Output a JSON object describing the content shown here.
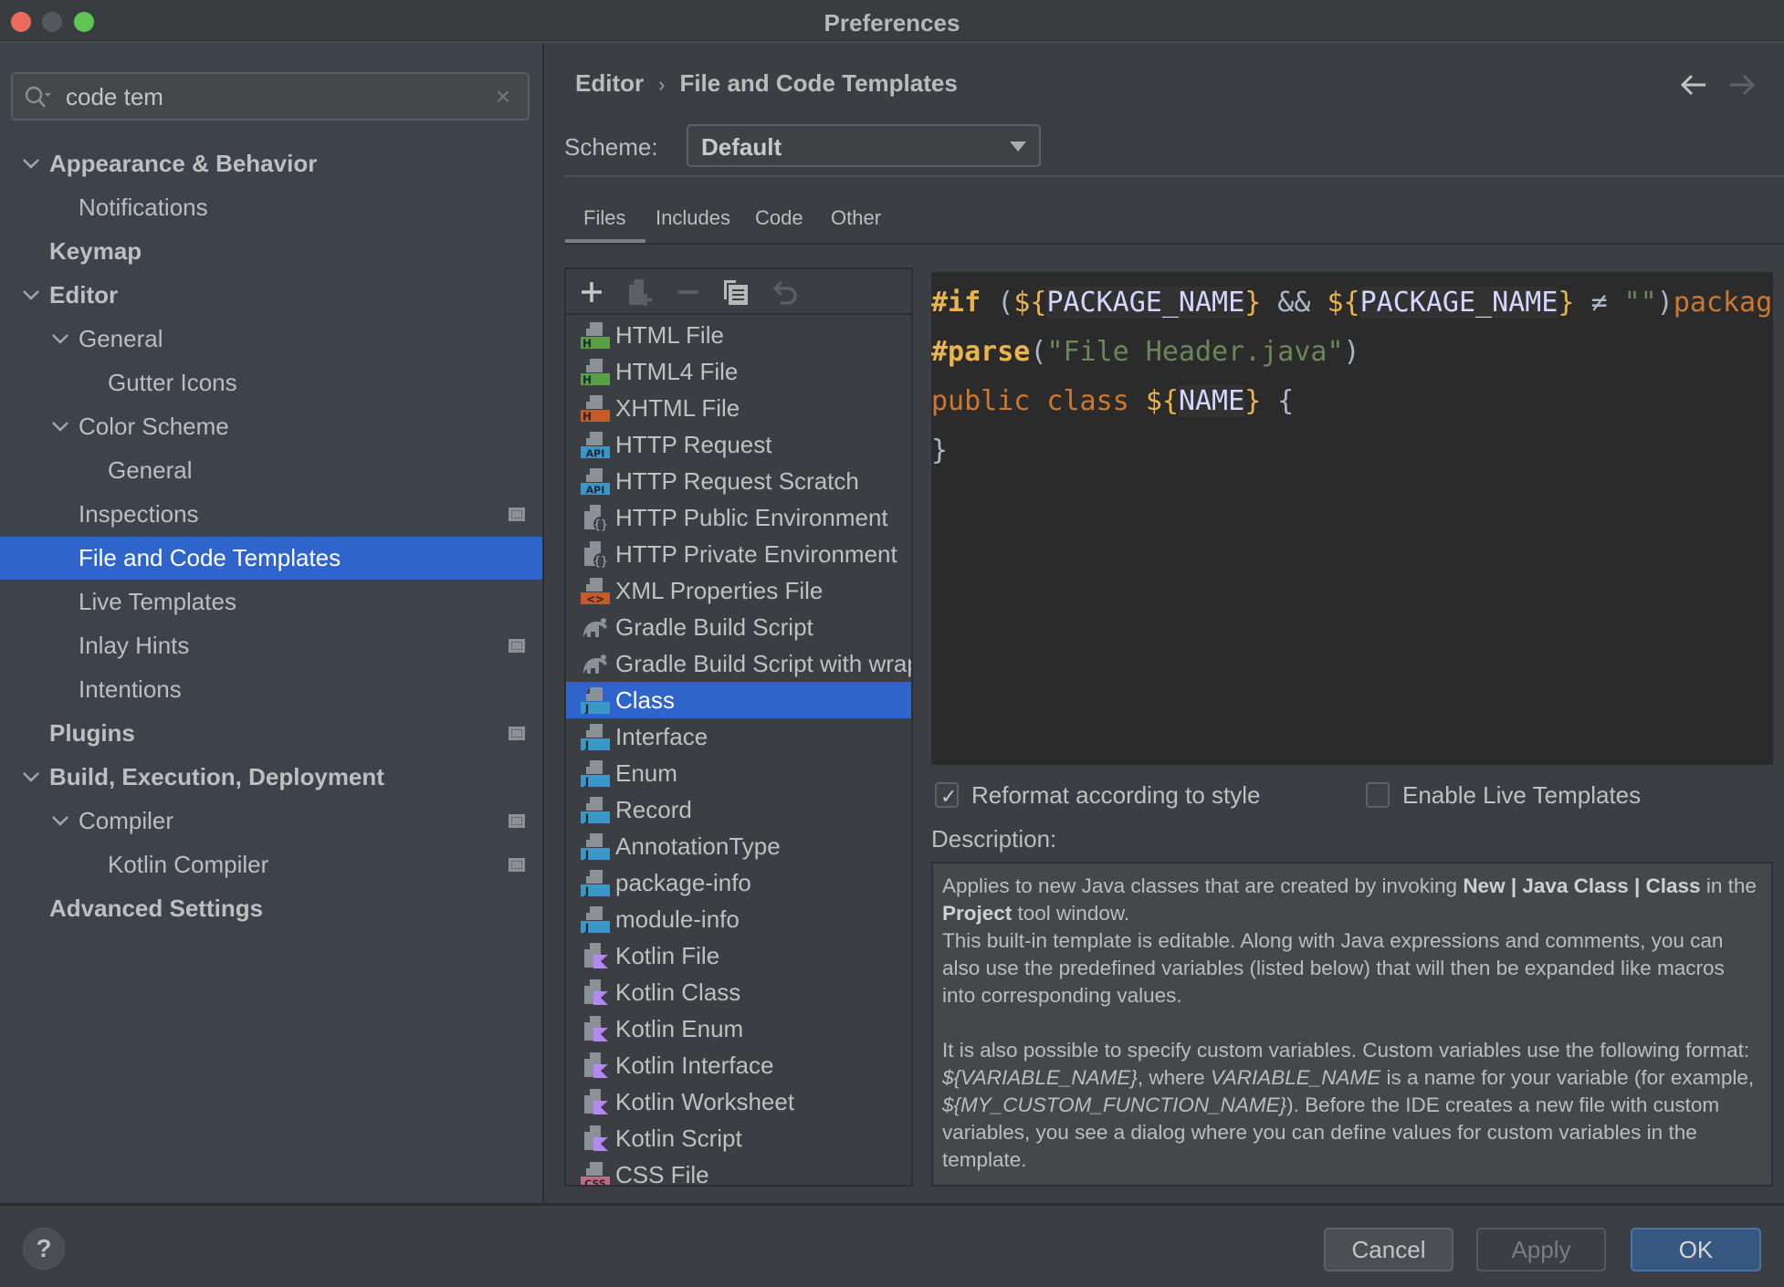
{
  "window": {
    "title": "Preferences"
  },
  "sidebar": {
    "search": {
      "value": "code tem",
      "placeholder": ""
    },
    "items": [
      {
        "label": "Appearance & Behavior",
        "level": 0,
        "bold": true,
        "expanded": true,
        "badge": false
      },
      {
        "label": "Notifications",
        "level": 1,
        "bold": false,
        "badge": false
      },
      {
        "label": "Keymap",
        "level": 0,
        "bold": true,
        "badge": false
      },
      {
        "label": "Editor",
        "level": 0,
        "bold": true,
        "expanded": true,
        "badge": false
      },
      {
        "label": "General",
        "level": 1,
        "bold": false,
        "expanded": true,
        "badge": false
      },
      {
        "label": "Gutter Icons",
        "level": 2,
        "bold": false,
        "badge": false
      },
      {
        "label": "Color Scheme",
        "level": 1,
        "bold": false,
        "expanded": true,
        "badge": false
      },
      {
        "label": "General",
        "level": 2,
        "bold": false,
        "badge": false
      },
      {
        "label": "Inspections",
        "level": 1,
        "bold": false,
        "badge": true
      },
      {
        "label": "File and Code Templates",
        "level": 1,
        "bold": false,
        "selected": true,
        "badge": false
      },
      {
        "label": "Live Templates",
        "level": 1,
        "bold": false,
        "badge": false
      },
      {
        "label": "Inlay Hints",
        "level": 1,
        "bold": false,
        "badge": true
      },
      {
        "label": "Intentions",
        "level": 1,
        "bold": false,
        "badge": false
      },
      {
        "label": "Plugins",
        "level": 0,
        "bold": true,
        "badge": true
      },
      {
        "label": "Build, Execution, Deployment",
        "level": 0,
        "bold": true,
        "expanded": true,
        "badge": false
      },
      {
        "label": "Compiler",
        "level": 1,
        "bold": false,
        "expanded": true,
        "badge": true
      },
      {
        "label": "Kotlin Compiler",
        "level": 2,
        "bold": false,
        "badge": true
      },
      {
        "label": "Advanced Settings",
        "level": 0,
        "bold": true,
        "badge": false
      }
    ]
  },
  "header": {
    "breadcrumb": [
      "Editor",
      "File and Code Templates"
    ],
    "breadcrumb_separator": "›",
    "back_icon": "arrow-left-icon",
    "forward_icon": "arrow-right-icon"
  },
  "scheme": {
    "label": "Scheme:",
    "value": "Default"
  },
  "tabs": [
    {
      "label": "Files",
      "active": true
    },
    {
      "label": "Includes",
      "active": false
    },
    {
      "label": "Code",
      "active": false
    },
    {
      "label": "Other",
      "active": false
    }
  ],
  "list_toolbar": [
    {
      "icon": "add-icon",
      "enabled": true
    },
    {
      "icon": "add-child-file-icon",
      "enabled": false
    },
    {
      "icon": "remove-icon",
      "enabled": false
    },
    {
      "icon": "copy-icon",
      "enabled": true
    },
    {
      "icon": "reset-icon",
      "enabled": false
    }
  ],
  "templates": [
    {
      "name": "HTML File",
      "icon": "html",
      "color": "#5a9e45",
      "tag": "H"
    },
    {
      "name": "HTML4 File",
      "icon": "html",
      "color": "#5a9e45",
      "tag": "H"
    },
    {
      "name": "XHTML File",
      "icon": "xhtml",
      "color": "#c75a27",
      "tag": "H"
    },
    {
      "name": "HTTP Request",
      "icon": "api",
      "color": "#3b97c5",
      "tag": "API"
    },
    {
      "name": "HTTP Request Scratch",
      "icon": "api",
      "color": "#3b97c5",
      "tag": "API"
    },
    {
      "name": "HTTP Public Environment",
      "icon": "json",
      "color": "#8a9199",
      "tag": "{}"
    },
    {
      "name": "HTTP Private Environment",
      "icon": "json",
      "color": "#8a9199",
      "tag": "{}"
    },
    {
      "name": "XML Properties File",
      "icon": "xml",
      "color": "#c75a27",
      "tag": "<>"
    },
    {
      "name": "Gradle Build Script",
      "icon": "gradle",
      "color": "#8a9199",
      "tag": ""
    },
    {
      "name": "Gradle Build Script with wrapper",
      "icon": "gradle",
      "color": "#8a9199",
      "tag": ""
    },
    {
      "name": "Class",
      "icon": "java",
      "color": "#3b97c5",
      "tag": "J",
      "selected": true
    },
    {
      "name": "Interface",
      "icon": "java",
      "color": "#3b97c5",
      "tag": "J"
    },
    {
      "name": "Enum",
      "icon": "java",
      "color": "#3b97c5",
      "tag": "J"
    },
    {
      "name": "Record",
      "icon": "java",
      "color": "#3b97c5",
      "tag": "J"
    },
    {
      "name": "AnnotationType",
      "icon": "java",
      "color": "#3b97c5",
      "tag": "J"
    },
    {
      "name": "package-info",
      "icon": "java",
      "color": "#3b97c5",
      "tag": "J"
    },
    {
      "name": "module-info",
      "icon": "java",
      "color": "#3b97c5",
      "tag": "J"
    },
    {
      "name": "Kotlin File",
      "icon": "kotlin",
      "color": "#b388f3",
      "tag": "K"
    },
    {
      "name": "Kotlin Class",
      "icon": "kotlin",
      "color": "#b388f3",
      "tag": "K"
    },
    {
      "name": "Kotlin Enum",
      "icon": "kotlin",
      "color": "#b388f3",
      "tag": "K"
    },
    {
      "name": "Kotlin Interface",
      "icon": "kotlin",
      "color": "#b388f3",
      "tag": "K"
    },
    {
      "name": "Kotlin Worksheet",
      "icon": "kotlin",
      "color": "#b388f3",
      "tag": "K"
    },
    {
      "name": "Kotlin Script",
      "icon": "kotlin",
      "color": "#b388f3",
      "tag": "K"
    },
    {
      "name": "CSS File",
      "icon": "css",
      "color": "#c26a7e",
      "tag": "CSS"
    }
  ],
  "code": {
    "lines": [
      [
        {
          "t": "#if",
          "c": "dir"
        },
        {
          "t": " (",
          "c": "punc"
        },
        {
          "t": "${",
          "c": "brace"
        },
        {
          "t": "PACKAGE_NAME",
          "c": "var"
        },
        {
          "t": "}",
          "c": "brace"
        },
        {
          "t": " && ",
          "c": "op"
        },
        {
          "t": "${",
          "c": "brace"
        },
        {
          "t": "PACKAGE_NAME",
          "c": "var"
        },
        {
          "t": "}",
          "c": "brace"
        },
        {
          "t": " ≠ ",
          "c": "op"
        },
        {
          "t": "\"\"",
          "c": "str"
        },
        {
          "t": ")",
          "c": "punc"
        },
        {
          "t": "package ${PACKAGE_NAME};#end",
          "c": "kw"
        }
      ],
      [
        {
          "t": "#parse",
          "c": "dir"
        },
        {
          "t": "(",
          "c": "punc"
        },
        {
          "t": "\"File Header.java\"",
          "c": "str"
        },
        {
          "t": ")",
          "c": "punc"
        }
      ],
      [
        {
          "t": "public class ",
          "c": "kw"
        },
        {
          "t": "${",
          "c": "brace"
        },
        {
          "t": "NAME",
          "c": "var"
        },
        {
          "t": "}",
          "c": "brace"
        },
        {
          "t": " {",
          "c": "punc"
        }
      ],
      [
        {
          "t": "}",
          "c": "punc"
        }
      ]
    ]
  },
  "options": {
    "reformat": {
      "label": "Reformat according to style",
      "checked": true
    },
    "live_templates": {
      "label": "Enable Live Templates",
      "checked": false
    }
  },
  "description": {
    "label": "Description:",
    "p1": [
      {
        "t": "Applies to new Java classes that are created by invoking "
      },
      {
        "t": "New | Java Class | Class",
        "b": true
      },
      {
        "t": " in the "
      },
      {
        "t": "Project",
        "b": true
      },
      {
        "t": " tool window."
      }
    ],
    "p2": "This built-in template is editable. Along with Java expressions and comments, you can also use the predefined variables (listed below) that will then be expanded like macros into corresponding values.",
    "p3": [
      {
        "t": "It is also possible to specify custom variables. Custom variables use the following format: "
      },
      {
        "t": "${VARIABLE_NAME}",
        "i": true
      },
      {
        "t": ", where "
      },
      {
        "t": "VARIABLE_NAME",
        "i": true
      },
      {
        "t": " is a name for your variable (for example, "
      },
      {
        "t": "${MY_CUSTOM_FUNCTION_NAME}",
        "i": true
      },
      {
        "t": "). Before the IDE creates a new file with custom variables, you see a dialog where you can define values for custom variables in the template."
      }
    ]
  },
  "footer": {
    "help": "?",
    "cancel": "Cancel",
    "apply": "Apply",
    "ok": "OK"
  },
  "colors": {
    "accent": "#2f65ca",
    "ok_button": "#365880"
  }
}
